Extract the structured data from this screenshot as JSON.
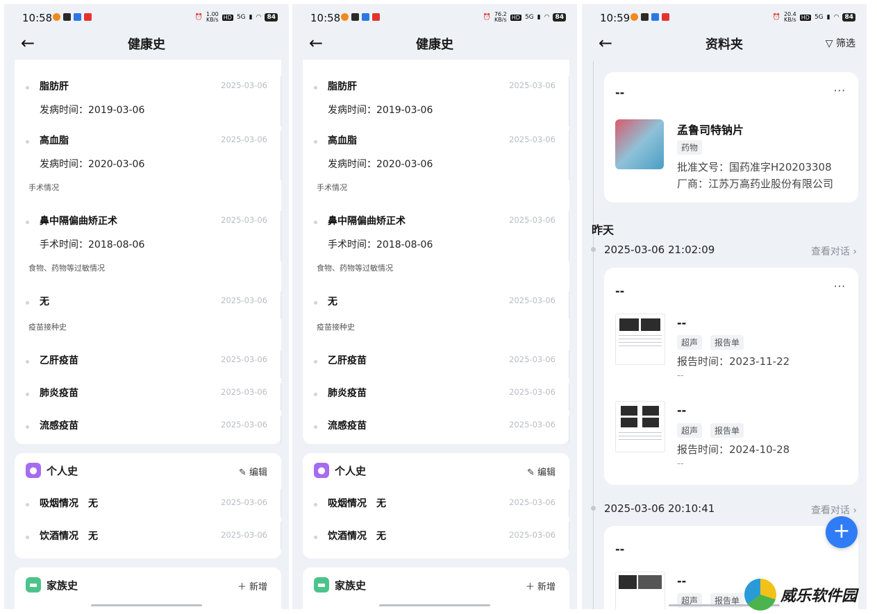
{
  "phone1": {
    "status": {
      "time": "10:58",
      "net": "1.00",
      "net_unit": "KB/s",
      "hd": "HD",
      "signal": "5G",
      "battery": "84"
    },
    "nav": {
      "title": "健康史"
    },
    "records": [
      {
        "name": "脂肪肝",
        "date": "2025-03-06",
        "sub": "发病时间：2019-03-06"
      },
      {
        "name": "高血脂",
        "date": "2025-03-06",
        "sub": "发病时间：2020-03-06"
      }
    ],
    "surgery_label": "手术情况",
    "surgery": {
      "name": "鼻中隔偏曲矫正术",
      "date": "2025-03-06",
      "sub": "手术时间：2018-08-06"
    },
    "allergy_label": "食物、药物等过敏情况",
    "allergy": {
      "name": "无",
      "date": "2025-03-06"
    },
    "vaccine_label": "疫苗接种史",
    "vaccines": [
      {
        "name": "乙肝疫苗",
        "date": "2025-03-06"
      },
      {
        "name": "肺炎疫苗",
        "date": "2025-03-06"
      },
      {
        "name": "流感疫苗",
        "date": "2025-03-06"
      }
    ],
    "personal": {
      "title": "个人史",
      "action": "编辑",
      "items": [
        {
          "name": "吸烟情况",
          "value": "无",
          "date": "2025-03-06"
        },
        {
          "name": "饮酒情况",
          "value": "无",
          "date": "2025-03-06"
        }
      ]
    },
    "family": {
      "title": "家族史",
      "action": "新增"
    }
  },
  "phone2": {
    "status": {
      "time": "10:58",
      "net": "76.2",
      "net_unit": "KB/s",
      "hd": "HD",
      "signal": "5G",
      "battery": "84"
    },
    "nav": {
      "title": "健康史"
    },
    "records": [
      {
        "name": "脂肪肝",
        "date": "2025-03-06",
        "sub": "发病时间：2019-03-06"
      },
      {
        "name": "高血脂",
        "date": "2025-03-06",
        "sub": "发病时间：2020-03-06"
      }
    ],
    "surgery_label": "手术情况",
    "surgery": {
      "name": "鼻中隔偏曲矫正术",
      "date": "2025-03-06",
      "sub": "手术时间：2018-08-06"
    },
    "allergy_label": "食物、药物等过敏情况",
    "allergy": {
      "name": "无",
      "date": "2025-03-06"
    },
    "vaccine_label": "疫苗接种史",
    "vaccines": [
      {
        "name": "乙肝疫苗",
        "date": "2025-03-06"
      },
      {
        "name": "肺炎疫苗",
        "date": "2025-03-06"
      },
      {
        "name": "流感疫苗",
        "date": "2025-03-06"
      }
    ],
    "personal": {
      "title": "个人史",
      "action": "编辑",
      "items": [
        {
          "name": "吸烟情况",
          "value": "无",
          "date": "2025-03-06"
        },
        {
          "name": "饮酒情况",
          "value": "无",
          "date": "2025-03-06"
        }
      ]
    },
    "family": {
      "title": "家族史",
      "action": "新增"
    }
  },
  "phone3": {
    "status": {
      "time": "10:59",
      "net": "20.4",
      "net_unit": "KB/s",
      "hd": "HD",
      "signal": "5G",
      "battery": "84"
    },
    "nav": {
      "title": "资料夹",
      "filter": "筛选"
    },
    "card1": {
      "title": "--",
      "drug_name": "孟鲁司特钠片",
      "tag": "药物",
      "approval": "批准文号：国药准字H20203308",
      "maker": "厂商：江苏万高药业股份有限公司"
    },
    "yesterday": "昨天",
    "group1": {
      "timestamp": "2025-03-06 21:02:09",
      "view": "查看对话",
      "title": "--",
      "reports": [
        {
          "name": "--",
          "tags": [
            "超声",
            "报告单"
          ],
          "time": "报告时间：2023-11-22",
          "note": "--"
        },
        {
          "name": "--",
          "tags": [
            "超声",
            "报告单"
          ],
          "time": "报告时间：2024-10-28",
          "note": "--"
        }
      ]
    },
    "group2": {
      "timestamp": "2025-03-06 20:10:41",
      "view": "查看对话",
      "title": "--",
      "report": {
        "name": "--",
        "tags": [
          "超声",
          "报告单"
        ]
      }
    },
    "fab": "+"
  },
  "watermark": "威乐软件园",
  "icons": [
    "back-arrow-icon",
    "filter-icon",
    "edit-icon",
    "plus-icon",
    "more-icon",
    "chevron-right-icon",
    "person-icon",
    "family-icon"
  ]
}
